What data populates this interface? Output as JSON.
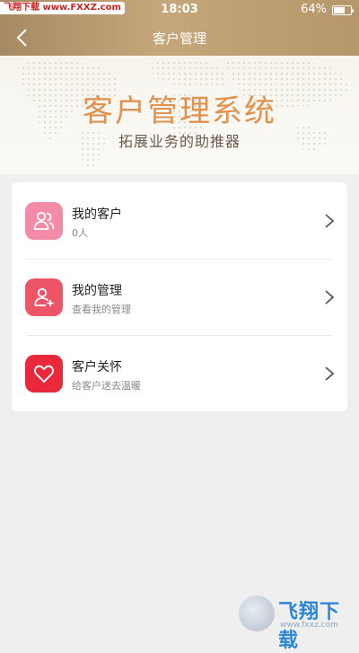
{
  "status_bar": {
    "watermark": "飞翔下载 www.FXXZ.com",
    "time": "18:03",
    "battery": "64%"
  },
  "nav": {
    "title": "客户管理"
  },
  "banner": {
    "title": "客户管理系统",
    "subtitle": "拓展业务的助推器"
  },
  "menu": {
    "items": [
      {
        "title": "我的客户",
        "subtitle": "0人",
        "icon": "users-icon",
        "color": "#f38aa8"
      },
      {
        "title": "我的管理",
        "subtitle": "查看我的管理",
        "icon": "add-user-icon",
        "color": "#ee5467"
      },
      {
        "title": "客户关怀",
        "subtitle": "给客户送去温暖",
        "icon": "heart-icon",
        "color": "#e9283c"
      }
    ]
  },
  "bottom_watermark": {
    "brand": "飞翔下载",
    "url": "www.fxxz.com"
  },
  "colors": {
    "nav_gold": "#b6976b",
    "banner_title": "#e0914c",
    "page_bg": "#efefef"
  }
}
